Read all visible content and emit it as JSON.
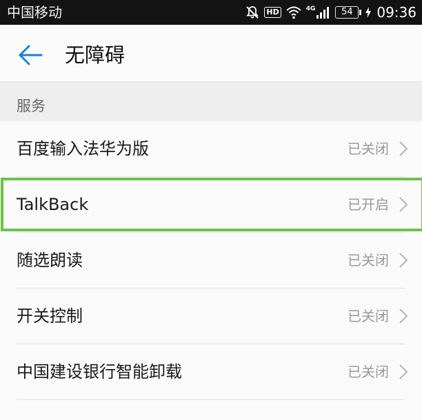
{
  "status_bar": {
    "carrier": "中国移动",
    "hd_label": "HD",
    "network_label": "4G",
    "battery_level": "54",
    "time": "09:36"
  },
  "header": {
    "title": "无障碍",
    "back_icon": "arrow-left-icon"
  },
  "section": {
    "label": "服务"
  },
  "list": {
    "items": [
      {
        "label": "百度输入法华为版",
        "status": "已关闭"
      },
      {
        "label": "TalkBack",
        "status": "已开启"
      },
      {
        "label": "随选朗读",
        "status": "已关闭"
      },
      {
        "label": "开关控制",
        "status": "已关闭"
      },
      {
        "label": "中国建设银行智能卸载",
        "status": "已关闭"
      }
    ]
  },
  "colors": {
    "accent": "#1a7fd6",
    "highlight": "#6cc24a",
    "status_bar_bg": "#131313"
  }
}
